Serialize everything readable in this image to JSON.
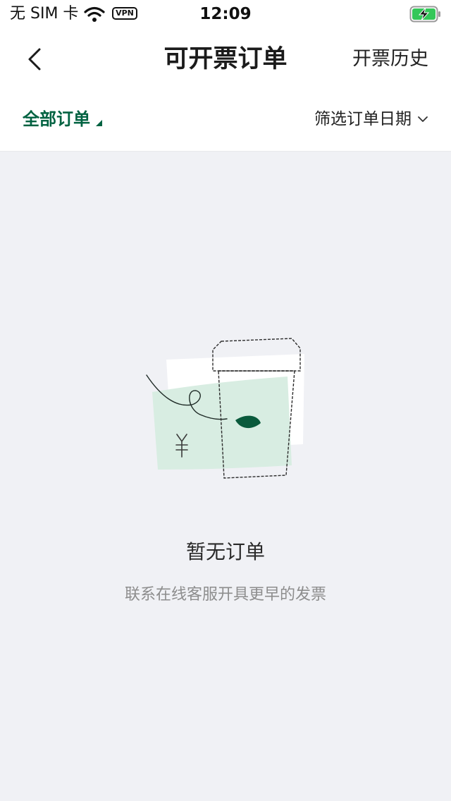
{
  "status_bar": {
    "carrier": "无 SIM 卡",
    "vpn": "VPN",
    "time": "12:09"
  },
  "nav": {
    "title": "可开票订单",
    "history": "开票历史"
  },
  "filter": {
    "all_orders": "全部订单",
    "date_filter": "筛选订单日期"
  },
  "empty_state": {
    "title": "暂无订单",
    "subtitle": "联系在线客服开具更早的发票"
  },
  "colors": {
    "brand_green": "#006241",
    "background": "#f0f1f5",
    "illustration_mint": "#d8ede2"
  },
  "icons": {
    "back": "chevron-left-icon",
    "wifi": "wifi-icon",
    "battery": "battery-charging-icon",
    "date_filter": "chevron-down-icon",
    "empty": "coffee-cup-receipt-illustration"
  }
}
